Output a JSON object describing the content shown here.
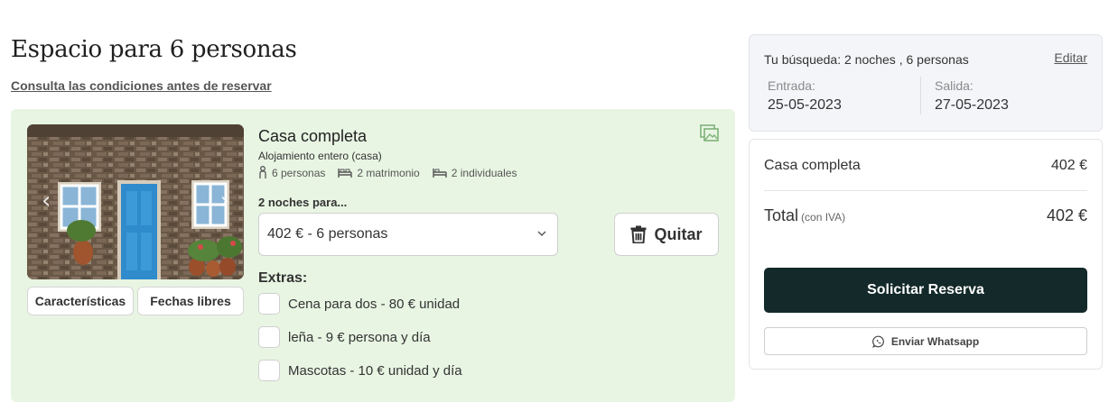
{
  "listing": {
    "title": "Espacio para 6 personas",
    "conditions_link": "Consulta las condiciones antes de reservar"
  },
  "unit": {
    "name": "Casa completa",
    "subtitle": "Alojamiento entero (casa)",
    "amenities": [
      {
        "icon": "person-icon",
        "label": "6 personas"
      },
      {
        "icon": "double-bed-icon",
        "label": "2 matrimonio"
      },
      {
        "icon": "single-bed-icon",
        "label": "2 individuales"
      }
    ],
    "buttons": {
      "features": "Características",
      "free_dates": "Fechas libres"
    },
    "nights_label": "2 noches para...",
    "rate_selected": "402 € - 6 personas",
    "remove_label": "Quitar",
    "extras_label": "Extras:",
    "extras": [
      {
        "label": "Cena para dos - 80 € unidad",
        "checked": false
      },
      {
        "label": "leña - 9 € persona y día",
        "checked": false
      },
      {
        "label": "Mascotas - 10 € unidad y día",
        "checked": false
      }
    ]
  },
  "search": {
    "summary": "Tu búsqueda: 2 noches , 6 personas",
    "edit_label": "Editar",
    "checkin_label": "Entrada:",
    "checkin_value": "25-05-2023",
    "checkout_label": "Salida:",
    "checkout_value": "27-05-2023"
  },
  "summary": {
    "line_label": "Casa completa",
    "line_price": "402 €",
    "total_label": "Total",
    "total_note": "(con IVA)",
    "total_price": "402 €",
    "request_label": "Solicitar Reserva",
    "whatsapp_label": "Enviar Whatsapp"
  },
  "colors": {
    "card_background": "#e8f5e3",
    "primary_button": "#13292a",
    "gallery_icon": "#7fb27a"
  }
}
